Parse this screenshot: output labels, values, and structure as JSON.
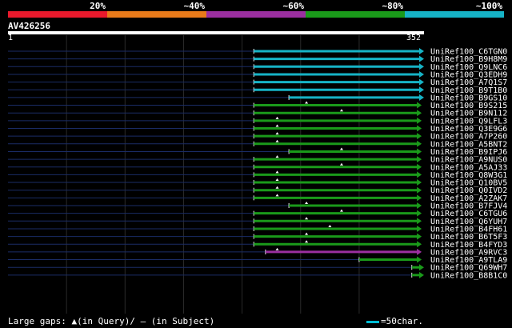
{
  "legend": {
    "labels": [
      "20%",
      "~40%",
      "~60%",
      "~80%",
      "~100%"
    ],
    "colors": [
      "#e8192c",
      "#e87a1a",
      "#9b2fa0",
      "#1a9a1a",
      "#16b3c6"
    ]
  },
  "query": {
    "name": "AV426256",
    "start": "1",
    "end": "352",
    "length": 352
  },
  "footer": {
    "gaps_text": "Large gaps: ▲(in Query)/ — (in Subject)",
    "scale_text": "=50char."
  },
  "chart_data": {
    "type": "alignment",
    "query_length": 352,
    "hits": [
      {
        "name": "UniRef100_C6TGN0",
        "start": 210,
        "end": 352,
        "color": "#16b3c6",
        "gap": null
      },
      {
        "name": "UniRef100_B9H8M9",
        "start": 210,
        "end": 352,
        "color": "#16b3c6",
        "gap": null
      },
      {
        "name": "UniRef100_Q9LNC6",
        "start": 210,
        "end": 352,
        "color": "#16b3c6",
        "gap": null
      },
      {
        "name": "UniRef100_Q3EDH9",
        "start": 210,
        "end": 352,
        "color": "#16b3c6",
        "gap": null
      },
      {
        "name": "UniRef100_A7Q1S7",
        "start": 210,
        "end": 352,
        "color": "#16b3c6",
        "gap": null
      },
      {
        "name": "UniRef100_B9T1B0",
        "start": 210,
        "end": 352,
        "color": "#16b3c6",
        "gap": null
      },
      {
        "name": "UniRef100_B9GS10",
        "start": 240,
        "end": 352,
        "color": "#16b3c6",
        "gap": null
      },
      {
        "name": "UniRef100_B9S215",
        "start": 210,
        "end": 350,
        "color": "#1a9a1a",
        "gap": 255
      },
      {
        "name": "UniRef100_B9N112",
        "start": 210,
        "end": 350,
        "color": "#1a9a1a",
        "gap": 285
      },
      {
        "name": "UniRef100_Q9LFL3",
        "start": 210,
        "end": 350,
        "color": "#1a9a1a",
        "gap": 230
      },
      {
        "name": "UniRef100_Q3E9G6",
        "start": 210,
        "end": 350,
        "color": "#1a9a1a",
        "gap": 230
      },
      {
        "name": "UniRef100_A7P260",
        "start": 210,
        "end": 350,
        "color": "#1a9a1a",
        "gap": 230
      },
      {
        "name": "UniRef100_A5BNT2",
        "start": 210,
        "end": 350,
        "color": "#1a9a1a",
        "gap": 230
      },
      {
        "name": "UniRef100_B9IPJ6",
        "start": 240,
        "end": 350,
        "color": "#1a9a1a",
        "gap": 285
      },
      {
        "name": "UniRef100_A9NUS0",
        "start": 210,
        "end": 350,
        "color": "#1a9a1a",
        "gap": 230
      },
      {
        "name": "UniRef100_A5AJ33",
        "start": 210,
        "end": 350,
        "color": "#1a9a1a",
        "gap": 285
      },
      {
        "name": "UniRef100_Q8W3G1",
        "start": 210,
        "end": 350,
        "color": "#1a9a1a",
        "gap": 230
      },
      {
        "name": "UniRef100_Q10BV5",
        "start": 210,
        "end": 350,
        "color": "#1a9a1a",
        "gap": 230
      },
      {
        "name": "UniRef100_Q0IVD2",
        "start": 210,
        "end": 350,
        "color": "#1a9a1a",
        "gap": 230
      },
      {
        "name": "UniRef100_A2ZAK7",
        "start": 210,
        "end": 350,
        "color": "#1a9a1a",
        "gap": 230
      },
      {
        "name": "UniRef100_B7FJV4",
        "start": 240,
        "end": 350,
        "color": "#1a9a1a",
        "gap": 255
      },
      {
        "name": "UniRef100_C6TGU6",
        "start": 210,
        "end": 350,
        "color": "#1a9a1a",
        "gap": 285
      },
      {
        "name": "UniRef100_Q6YUH7",
        "start": 210,
        "end": 350,
        "color": "#1a9a1a",
        "gap": 255
      },
      {
        "name": "UniRef100_B4FH61",
        "start": 210,
        "end": 350,
        "color": "#1a9a1a",
        "gap": 275
      },
      {
        "name": "UniRef100_B6T5F3",
        "start": 210,
        "end": 350,
        "color": "#1a9a1a",
        "gap": 255
      },
      {
        "name": "UniRef100_B4FYD3",
        "start": 210,
        "end": 350,
        "color": "#1a9a1a",
        "gap": 255
      },
      {
        "name": "UniRef100_A9RVC3",
        "start": 220,
        "end": 350,
        "color": "#9b2fa0",
        "gap": 230
      },
      {
        "name": "UniRef100_A9TLA9",
        "start": 300,
        "end": 350,
        "color": "#1a9a1a",
        "gap": null
      },
      {
        "name": "UniRef100_Q69WH7",
        "start": 345,
        "end": 352,
        "color": "#1a9a1a",
        "gap": null
      },
      {
        "name": "UniRef100_B8B1C0",
        "start": 345,
        "end": 352,
        "color": "#1a9a1a",
        "gap": null
      }
    ]
  }
}
